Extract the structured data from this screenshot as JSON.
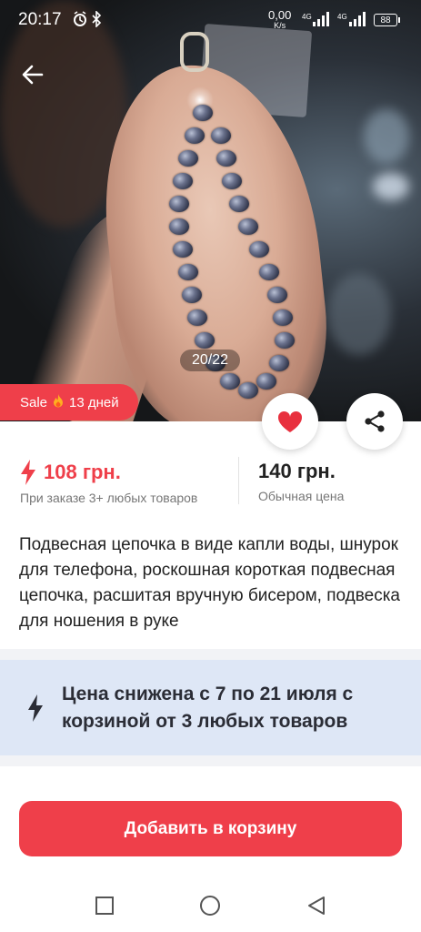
{
  "status_bar": {
    "time": "20:17",
    "speed_value": "0,00",
    "speed_unit": "K/s",
    "network_1": "4G",
    "network_2": "4G",
    "battery": "88",
    "icons": [
      "alarm-icon",
      "bluetooth-icon",
      "signal-icon",
      "signal-icon",
      "battery-icon"
    ]
  },
  "gallery": {
    "counter": "20/22"
  },
  "sale_badge": {
    "label": "Sale",
    "icon": "fire-icon",
    "days": "13 дней"
  },
  "prices": {
    "sale_price": "108 грн.",
    "sale_caption": "При заказе 3+ любых товаров",
    "regular_price": "140 грн.",
    "regular_caption": "Обычная цена"
  },
  "product": {
    "title": "Подвесная цепочка в виде капли воды, шнурок для телефона, роскошная короткая подвесная цепочка, расшитая вручную бисером, подвеска для ношения в руке"
  },
  "promo": {
    "text": "Цена снижена с 7 по 21 июля с корзиной от 3 любых товаров"
  },
  "actions": {
    "add_to_cart": "Добавить в корзину"
  },
  "colors": {
    "accent": "#ef3f4a",
    "promo_bg": "#dee7f6",
    "text": "#222222"
  }
}
